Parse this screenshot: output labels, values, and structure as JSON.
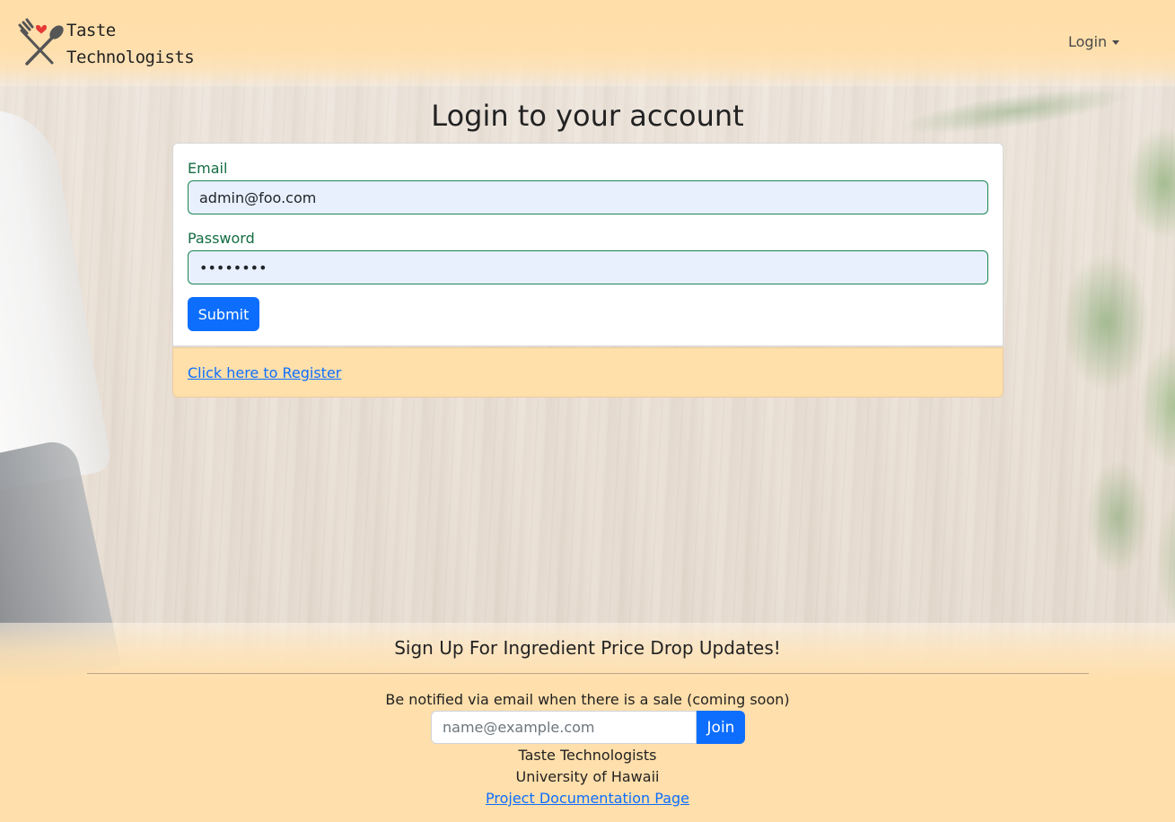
{
  "navbar": {
    "brand_line1": "Taste",
    "brand_line2": "Technologists",
    "login_label": "Login"
  },
  "login": {
    "title": "Login to your account",
    "email_label": "Email",
    "email_value": "admin@foo.com",
    "password_label": "Password",
    "password_value": "••••••••",
    "submit_label": "Submit",
    "register_link": "Click here to Register"
  },
  "footer": {
    "heading": "Sign Up For Ingredient Price Drop Updates!",
    "notice": "Be notified via email when there is a sale (coming soon)",
    "email_placeholder": "name@example.com",
    "join_label": "Join",
    "org_name": "Taste Technologists",
    "university": "University of Hawaii",
    "docs_link": "Project Documentation Page"
  },
  "colors": {
    "navbar_bg": "#ffdea9",
    "primary": "#0d6efd",
    "valid_green": "#198754",
    "register_panel_bg": "#ffdfaa",
    "logo_heart": "#e53935"
  },
  "icons": {
    "logo": "fork-spoon-heart-icon",
    "login_dropdown": "caret-down-icon"
  }
}
